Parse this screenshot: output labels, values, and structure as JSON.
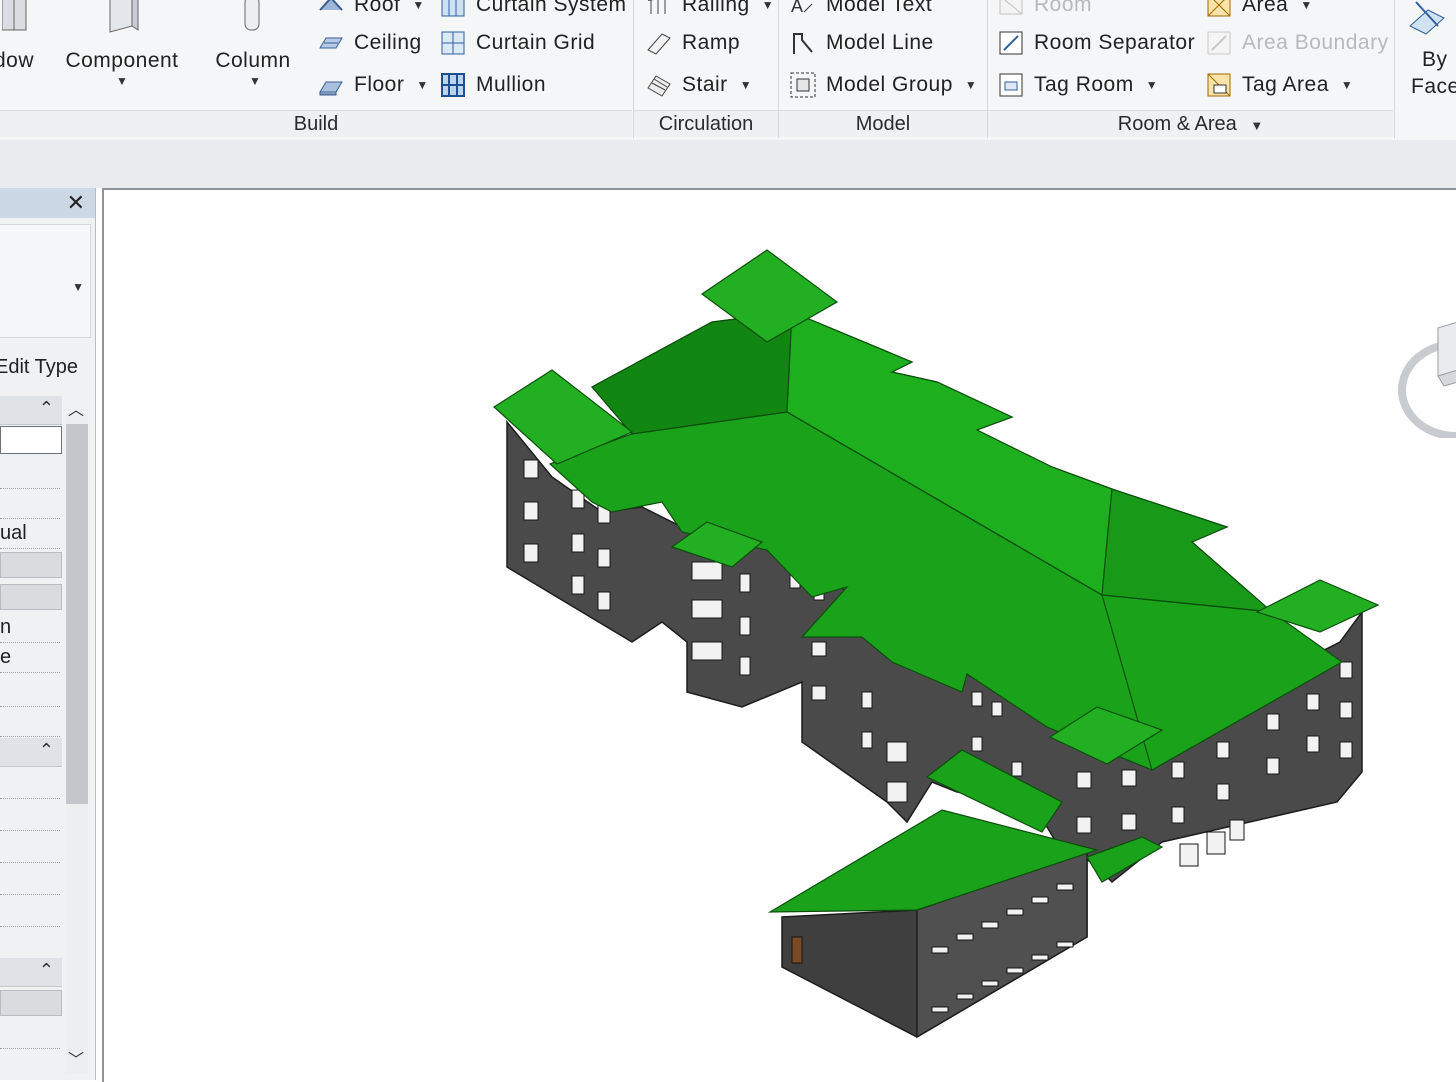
{
  "ribbon": {
    "build": {
      "label": "Build",
      "window_partial": "dow",
      "component": "Component",
      "column": "Column",
      "roof_partial": "Roof",
      "ceiling": "Ceiling",
      "floor": "Floor",
      "curtain_system_partial": "Curtain System",
      "curtain_grid": "Curtain Grid",
      "mullion": "Mullion"
    },
    "circulation": {
      "label": "Circulation",
      "railing_partial": "Railing",
      "ramp": "Ramp",
      "stair": "Stair"
    },
    "model": {
      "label": "Model",
      "model_text_partial": "Model Text",
      "model_line": "Model Line",
      "model_group": "Model Group"
    },
    "room_area": {
      "label": "Room & Area",
      "room_partial": "Room",
      "room_separator": "Room Separator",
      "tag_room": "Tag Room",
      "area_partial": "Area",
      "area_boundary": "Area Boundary",
      "tag_area": "Tag Area"
    },
    "opening": {
      "by_face_line1": "By",
      "by_face_line2": "Face"
    }
  },
  "properties": {
    "close_glyph": "✕",
    "edit_type_partial": "Edit Type",
    "row_ual": "ual",
    "row_n": "n",
    "row_e": "e"
  },
  "colors": {
    "roof_green": "#1aa21a",
    "roof_green_dark": "#128612",
    "wall_dark": "#4a4a4a"
  }
}
